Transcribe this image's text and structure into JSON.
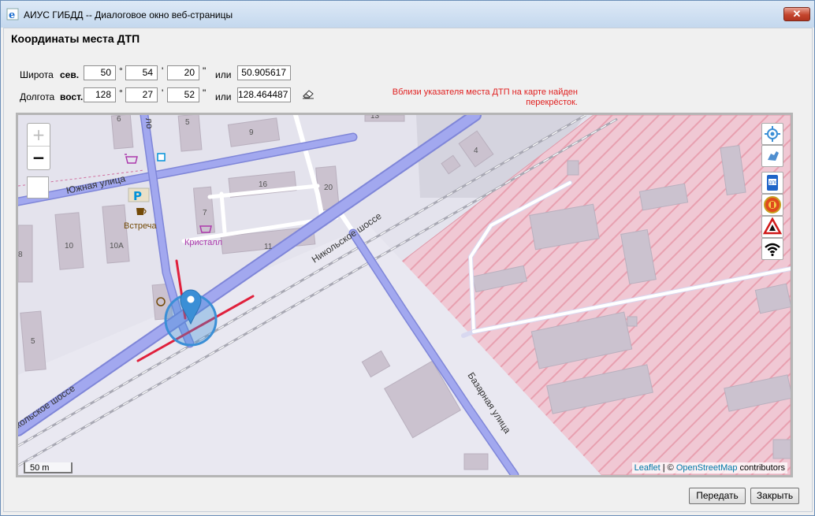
{
  "window": {
    "title": "АИУС ГИБДД -- Диалоговое окно веб-страницы",
    "close_label": "✕"
  },
  "form": {
    "heading": "Координаты места ДТП",
    "latitude": {
      "label": "Широта",
      "hemisphere": "сев.",
      "degrees": "50",
      "minutes": "54",
      "seconds": "20",
      "or_label": "или",
      "decimal": "50.905617"
    },
    "longitude": {
      "label": "Долгота",
      "hemisphere": "вост.",
      "degrees": "128",
      "minutes": "27",
      "seconds": "52",
      "or_label": "или",
      "decimal": "128.464487"
    },
    "symbols": {
      "degree": "°",
      "minute": "'",
      "second": "\""
    },
    "warning": "Вблизи указателя места ДТП на карте найден перекрёсток."
  },
  "map": {
    "zoom_in": "+",
    "zoom_out": "−",
    "scale_label": "50 m",
    "attribution": {
      "leaflet": "Leaflet",
      "separator": " | © ",
      "osm": "OpenStreetMap",
      "suffix": " contributors"
    },
    "streets": {
      "yuzhnaya": "Южная улица",
      "nikolskoe": "Никольское шоссе",
      "nikolskoe_left": "кольское шоссе",
      "bazarnaya": "Базарная улица",
      "cut_street": "ло"
    },
    "places": {
      "vstrecha": "Встреча",
      "kristall": "Кристалл"
    },
    "parking_label": "P",
    "house_numbers": [
      "6",
      "5",
      "9",
      "13",
      "4",
      "16",
      "20",
      "7",
      "10",
      "10A",
      "11",
      "8",
      "5"
    ],
    "controls": [
      "locate-icon",
      "hand-pointer-icon",
      "dps-sign-icon",
      "traffic-police-emblem-icon",
      "road-warning-sign-icon",
      "wifi-icon"
    ],
    "colors": {
      "restricted_area": "#e8a0b0",
      "roads": "#9aa0ea",
      "accident_marker": "#3b8fd6",
      "intersection_highlight": "#e0203c"
    }
  },
  "buttons": {
    "submit": "Передать",
    "close": "Закрыть"
  }
}
